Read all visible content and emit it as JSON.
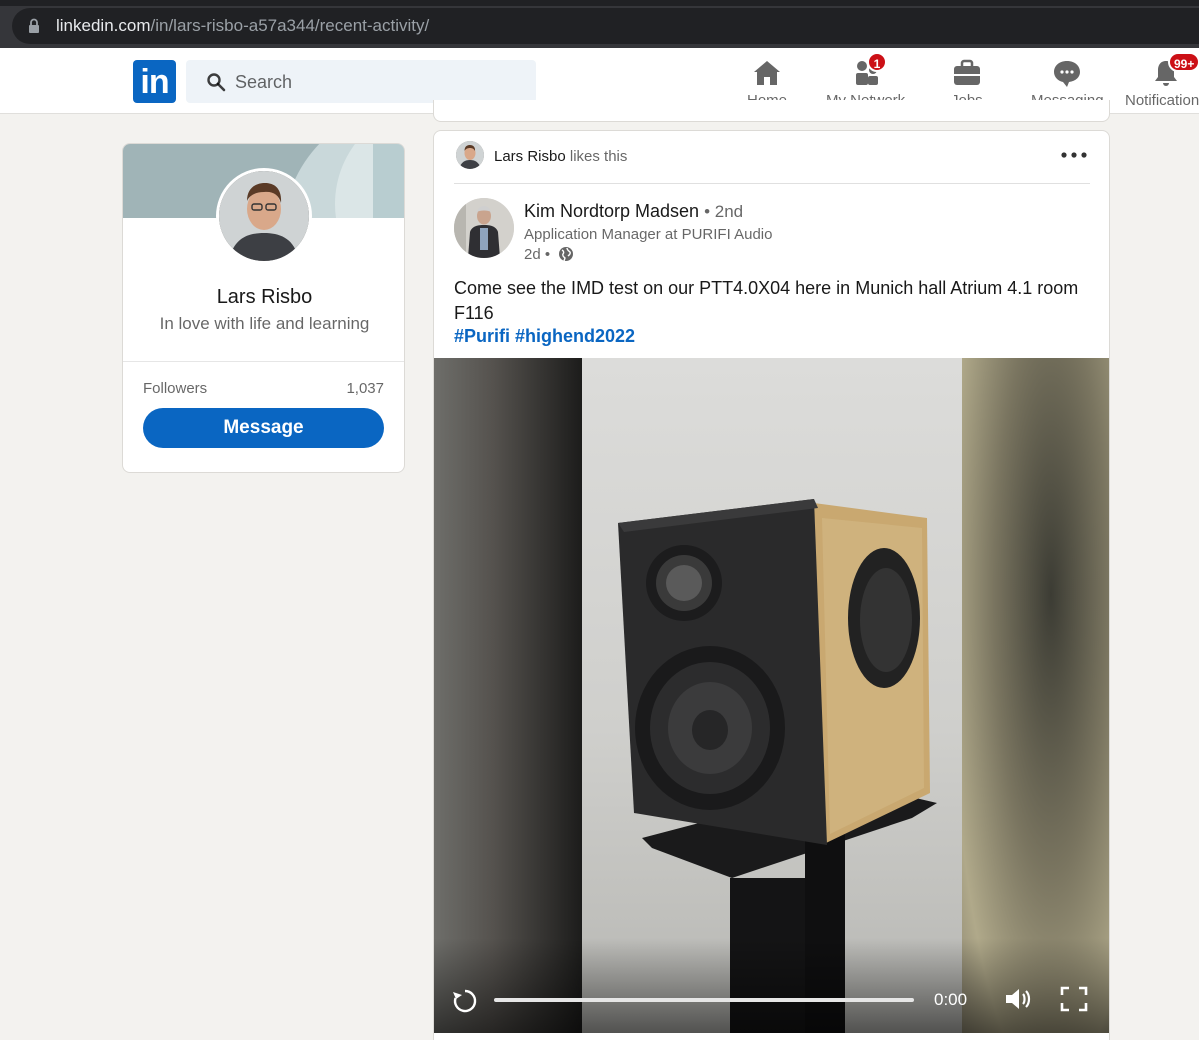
{
  "browser": {
    "url_host": "linkedin.com",
    "url_path": "/in/lars-risbo-a57a344/recent-activity/"
  },
  "header": {
    "logo_text": "in",
    "search_placeholder": "Search",
    "nav": {
      "home": "Home",
      "network": "My Network",
      "network_badge": "1",
      "jobs": "Jobs",
      "messaging": "Messaging",
      "notifications": "Notifications",
      "notifications_badge": "99+"
    }
  },
  "profile": {
    "name": "Lars Risbo",
    "headline": "In love with life and learning",
    "followers_label": "Followers",
    "followers_count": "1,037",
    "message_label": "Message"
  },
  "post": {
    "liker_name": "Lars Risbo",
    "liker_action": "likes this",
    "author_name": "Kim Nordtorp Madsen",
    "author_degree": "• 2nd",
    "author_title": "Application Manager at PURIFI Audio",
    "time": "2d •",
    "text": "Come see the IMD test on our PTT4.0X04 here in Munich hall Atrium 4.1 room F116",
    "hashtags": "#Purifi #highend2022",
    "video": {
      "time": "0:00",
      "progress_fraction": 0.0
    }
  },
  "colors": {
    "brand": "#0a66c2",
    "badge": "#cc1016",
    "page_bg": "#f3f2ef"
  }
}
